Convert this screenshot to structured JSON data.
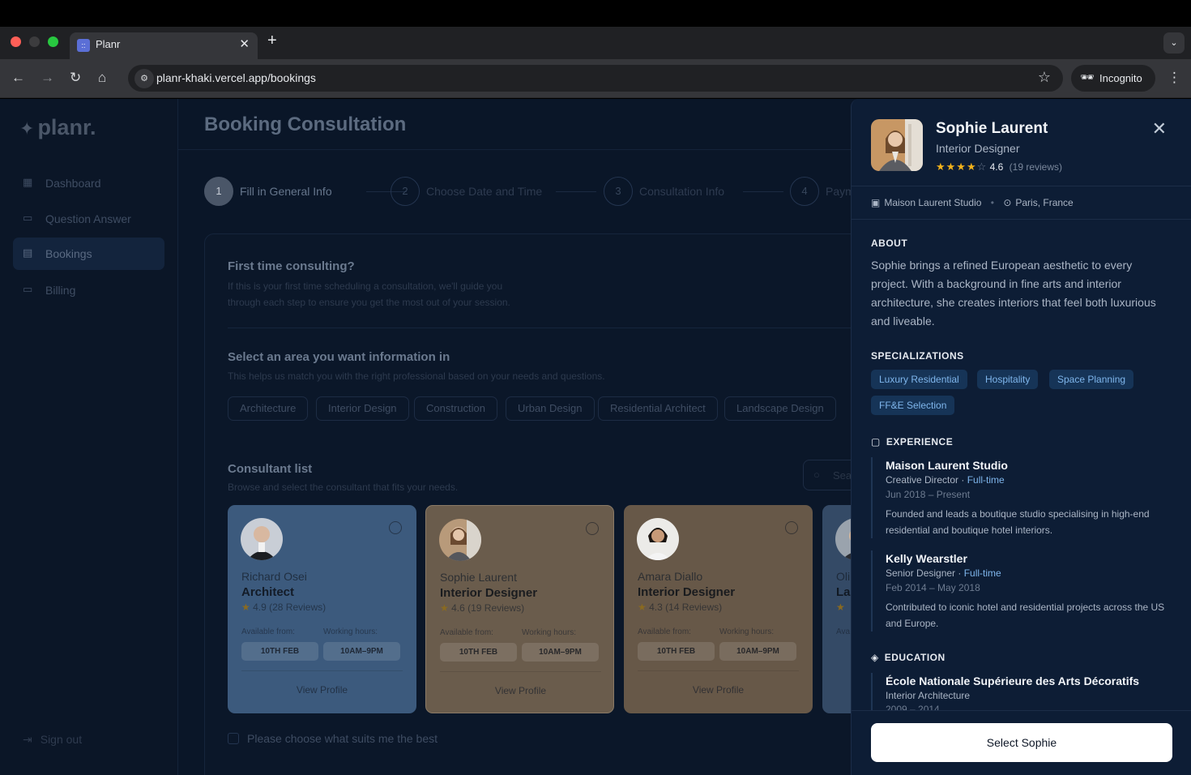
{
  "browser": {
    "tab_title": "Planr",
    "tab_favicon": "::",
    "url": "planr-khaki.vercel.app/bookings",
    "incognito_label": "Incognito"
  },
  "sidebar": {
    "logo": "planr.",
    "items": [
      {
        "label": "Dashboard",
        "icon": "dashboard-icon"
      },
      {
        "label": "Question Answer",
        "icon": "chat-icon"
      },
      {
        "label": "Bookings",
        "icon": "calendar-icon"
      },
      {
        "label": "Billing",
        "icon": "card-icon"
      }
    ],
    "sign_out": "Sign out"
  },
  "page": {
    "title": "Booking Consultation",
    "steps": [
      {
        "num": "1",
        "label": "Fill in General Info"
      },
      {
        "num": "2",
        "label": "Choose Date and Time"
      },
      {
        "num": "3",
        "label": "Consultation Info"
      },
      {
        "num": "4",
        "label": "Paym"
      }
    ]
  },
  "form": {
    "first_time_title": "First time consulting?",
    "first_time_desc_1": "If this is your first time scheduling a consultation, we'll guide you",
    "first_time_desc_2": "through each step to ensure you get the most out of your session.",
    "area_title": "Select an area you want information in",
    "area_desc": "This helps us match you with the right professional based on your needs and questions.",
    "areas": [
      "Architecture",
      "Interior Design",
      "Construction",
      "Urban Design",
      "Residential Architect",
      "Landscape Design"
    ],
    "consultant_title": "Consultant list",
    "consultant_desc": "Browse and select the consultant that fits your needs.",
    "search_placeholder": "Sea",
    "choose_best": "Please choose what suits me the best"
  },
  "consultants": [
    {
      "name": "Richard Osei",
      "role": "Architect",
      "rating": "4.9 (28 Reviews)",
      "available_label": "Available from:",
      "hours_label": "Working hours:",
      "available": "10TH FEB",
      "hours": "10AM–9PM",
      "view": "View Profile"
    },
    {
      "name": "Sophie Laurent",
      "role": "Interior Designer",
      "rating": "4.6 (19 Reviews)",
      "available_label": "Available from:",
      "hours_label": "Working hours:",
      "available": "10TH FEB",
      "hours": "10AM–9PM",
      "view": "View Profile"
    },
    {
      "name": "Amara Diallo",
      "role": "Interior Designer",
      "rating": "4.3 (14 Reviews)",
      "available_label": "Available from:",
      "hours_label": "Working hours:",
      "available": "10TH FEB",
      "hours": "10AM–9PM",
      "view": "View Profile"
    },
    {
      "name": "Oli",
      "role": "Lar",
      "available_label": "Ava"
    }
  ],
  "drawer": {
    "name": "Sophie Laurent",
    "title": "Interior Designer",
    "rating_value": "4.6",
    "rating_reviews": "(19 reviews)",
    "stars": "★★★★",
    "star_empty": "☆",
    "studio": "Maison Laurent Studio",
    "location": "Paris, France",
    "about_heading": "ABOUT",
    "about": "Sophie brings a refined European aesthetic to every project. With a background in fine arts and interior architecture, she creates interiors that feel both luxurious and liveable.",
    "spec_heading": "SPECIALIZATIONS",
    "specializations": [
      "Luxury Residential",
      "Hospitality",
      "Space Planning",
      "FF&E Selection"
    ],
    "exp_heading": "EXPERIENCE",
    "experience": [
      {
        "org": "Maison Laurent Studio",
        "role": "Creative Director",
        "type": "Full-time",
        "dates": "Jun 2018 – Present",
        "desc": "Founded and leads a boutique studio specialising in high-end residential and boutique hotel interiors."
      },
      {
        "org": "Kelly Wearstler",
        "role": "Senior Designer",
        "type": "Full-time",
        "dates": "Feb 2014 – May 2018",
        "desc": "Contributed to iconic hotel and residential projects across the US and Europe."
      }
    ],
    "edu_heading": "EDUCATION",
    "education": [
      {
        "school": "École Nationale Supérieure des Arts Décoratifs",
        "field": "Interior Architecture",
        "dates": "2009 – 2014"
      }
    ],
    "cta": "Select Sophie"
  },
  "colors": {
    "app_bg": "#0a1628",
    "drawer_bg": "#0d1d35",
    "accent_tag": "#163457",
    "star": "#f2b21b",
    "card_blue": "#3c5a7d",
    "card_tan": "#6a5c4c"
  }
}
